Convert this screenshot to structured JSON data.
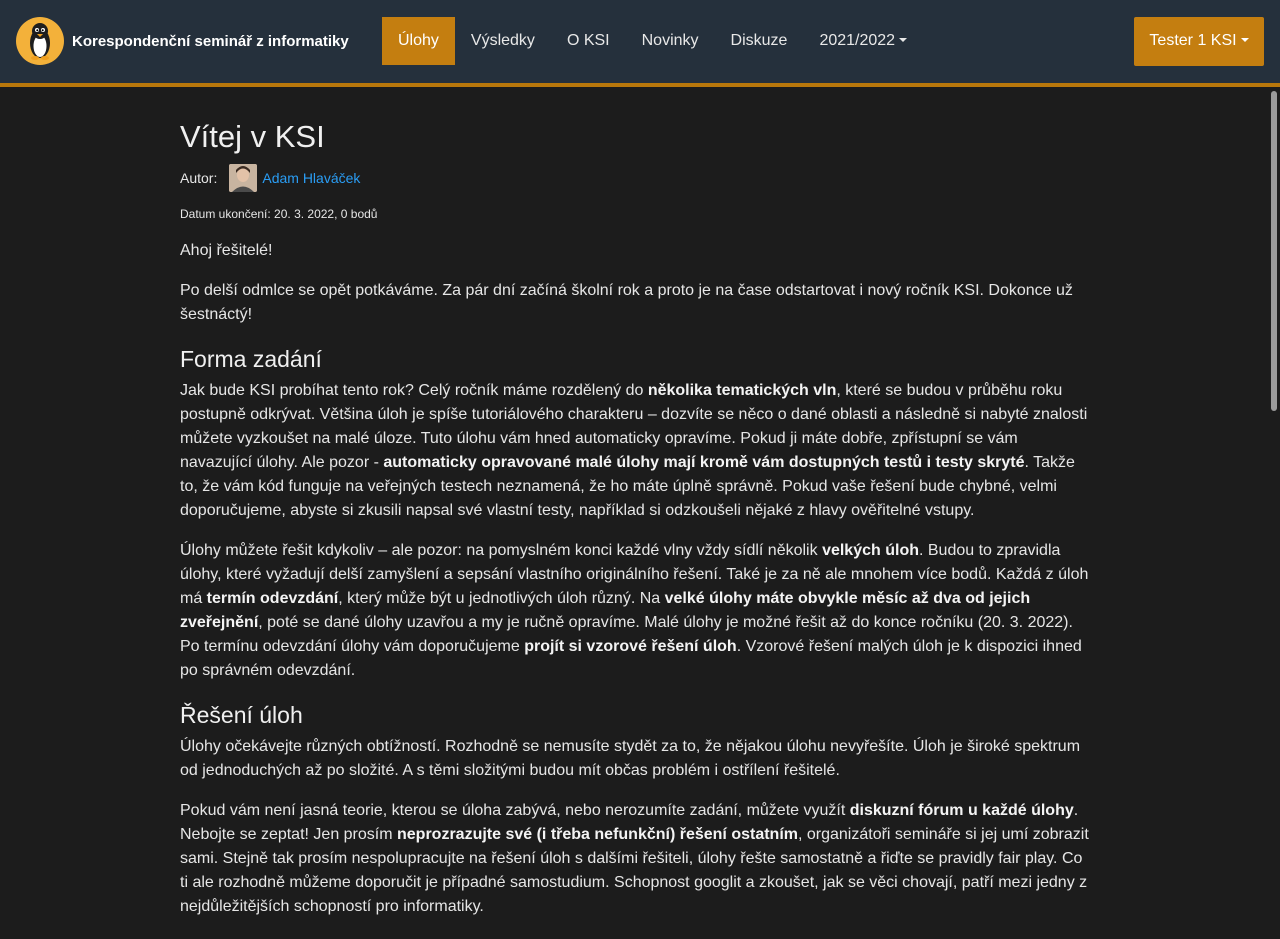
{
  "nav": {
    "brand_title": "Korespondenční seminář z informatiky",
    "items": [
      {
        "label": "Úlohy"
      },
      {
        "label": "Výsledky"
      },
      {
        "label": "O KSI"
      },
      {
        "label": "Novinky"
      },
      {
        "label": "Diskuze"
      },
      {
        "label": "2021/2022"
      }
    ],
    "user_label": "Tester 1 KSI"
  },
  "article": {
    "title": "Vítej v KSI",
    "author_label": "Autor:",
    "author_name": "Adam Hlaváček",
    "date_line": "Datum ukončení: 20. 3. 2022, 0 bodů",
    "greeting": "Ahoj řešitelé!",
    "intro": "Po delší odmlce se opět potkáváme. Za pár dní začíná školní rok a proto je na čase odstartovat i nový ročník KSI. Dokonce už šestnáctý!",
    "h_forma": "Forma zadání",
    "p1": [
      "Jak bude KSI probíhat tento rok? Celý ročník máme rozdělený do ",
      "několika tematických vln",
      ", které se budou v průběhu roku postupně odkrývat. Většina úloh je spíše tutoriálového charakteru – dozvíte se něco o dané oblasti a následně si nabyté znalosti můžete vyzkoušet na malé úloze. Tuto úlohu vám hned automaticky opravíme. Pokud ji máte dobře, zpřístupní se vám navazující úlohy. Ale pozor - ",
      "automaticky opravované malé úlohy mají kromě vám dostupných testů i testy skryté",
      ". Takže to, že vám kód funguje na veřejných testech neznamená, že ho máte úplně správně. Pokud vaše řešení bude chybné, velmi doporučujeme, abyste si zkusili napsal své vlastní testy, například si odzkoušeli nějaké z hlavy ověřitelné vstupy."
    ],
    "p2": [
      "Úlohy můžete řešit kdykoliv – ale pozor: na pomyslném konci každé vlny vždy sídlí několik ",
      "velkých úloh",
      ". Budou to zpravidla úlohy, které vyžadují delší zamyšlení a sepsání vlastního originálního řešení. Také je za ně ale mnohem více bodů. Každá z úloh má ",
      "termín odevzdání",
      ", který může být u jednotlivých úloh různý. Na ",
      "velké úlohy máte obvykle měsíc až dva od jejich zveřejnění",
      ", poté se dané úlohy uzavřou a my je ručně opravíme. Malé úlohy je možné řešit až do konce ročníku (20. 3. 2022). Po termínu odevzdání úlohy vám doporučujeme ",
      "projít si vzorové řešení úloh",
      ". Vzorové řešení malých úloh je k dispozici ihned po správném odevzdání."
    ],
    "h_reseni": "Řešení úloh",
    "p3": "Úlohy očekávejte různých obtížností. Rozhodně se nemusíte stydět za to, že nějakou úlohu nevyřešíte. Úloh je široké spektrum od jednoduchých až po složité. A s těmi složitými budou mít občas problém i ostřílení řešitelé.",
    "p4": [
      "Pokud vám není jasná teorie, kterou se úloha zabývá, nebo nerozumíte zadání, můžete využít ",
      "diskuzní fórum u každé úlohy",
      ". Nebojte se zeptat! Jen prosím ",
      "neprozrazujte své (i třeba nefunkční) řešení ostatním",
      ", organizátoři semináře si jej umí zobrazit sami. Stejně tak prosím nespolupracujte na řešení úloh s dalšími řešiteli, úlohy řešte samostatně a řiďte se pravidly fair play. Co ti ale rozhodně můžeme doporučit je případné samostudium. Schopnost googlit a zkoušet, jak se věci chovají, patří mezi jedny z nejdůležitějších schopností pro informatiky."
    ]
  }
}
